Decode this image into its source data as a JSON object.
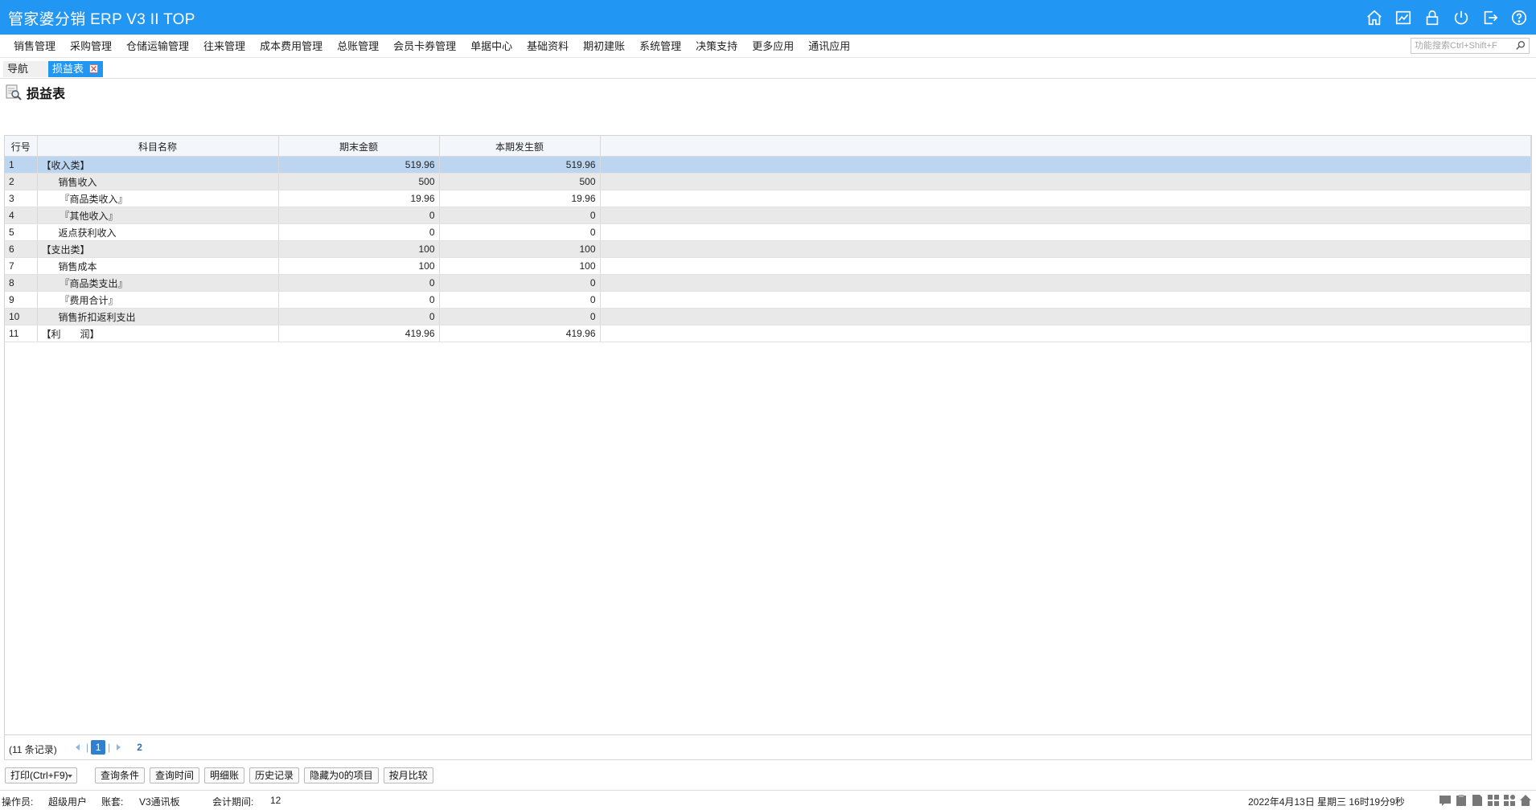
{
  "app": {
    "title": "管家婆分销 ERP V3 II TOP"
  },
  "menu": [
    {
      "label": "销售管理"
    },
    {
      "label": "采购管理"
    },
    {
      "label": "仓储运输管理"
    },
    {
      "label": "往来管理"
    },
    {
      "label": "成本费用管理"
    },
    {
      "label": "总账管理"
    },
    {
      "label": "会员卡券管理"
    },
    {
      "label": "单据中心"
    },
    {
      "label": "基础资料"
    },
    {
      "label": "期初建账"
    },
    {
      "label": "系统管理"
    },
    {
      "label": "决策支持"
    },
    {
      "label": "更多应用"
    },
    {
      "label": "通讯应用"
    }
  ],
  "search": {
    "placeholder": "功能搜索Ctrl+Shift+F"
  },
  "tabs": {
    "nav": "导航",
    "active": "损益表"
  },
  "page": {
    "title": "损益表"
  },
  "grid": {
    "headers": {
      "row": "行号",
      "name": "科目名称",
      "end": "期末金额",
      "period": "本期发生额"
    },
    "rows": [
      {
        "no": "1",
        "name": "【收入类】",
        "end": "519.96",
        "period": "519.96"
      },
      {
        "no": "2",
        "name": "销售收入",
        "end": "500",
        "period": "500"
      },
      {
        "no": "3",
        "name": "『商品类收入』",
        "end": "19.96",
        "period": "19.96"
      },
      {
        "no": "4",
        "name": "『其他收入』",
        "end": "0",
        "period": "0"
      },
      {
        "no": "5",
        "name": "返点获利收入",
        "end": "0",
        "period": "0"
      },
      {
        "no": "6",
        "name": "【支出类】",
        "end": "100",
        "period": "100"
      },
      {
        "no": "7",
        "name": "销售成本",
        "end": "100",
        "period": "100"
      },
      {
        "no": "8",
        "name": "『商品类支出』",
        "end": "0",
        "period": "0"
      },
      {
        "no": "9",
        "name": "『费用合计』",
        "end": "0",
        "period": "0"
      },
      {
        "no": "10",
        "name": "销售折扣返利支出",
        "end": "0",
        "period": "0"
      },
      {
        "no": "11",
        "name": "【利　　润】",
        "end": "419.96",
        "period": "419.96"
      }
    ]
  },
  "pager": {
    "records": "(11 条记录)",
    "current": "1",
    "total": "2"
  },
  "buttons": {
    "print": "打印(Ctrl+F9)",
    "query_cond": "查询条件",
    "query_time": "查询时间",
    "detail": "明细账",
    "history": "历史记录",
    "hide_zero": "隐藏为0的项目",
    "by_month": "按月比较"
  },
  "status": {
    "operator_label": "操作员:",
    "operator": "超级用户",
    "account_label": "账套:",
    "account": "V3通讯板",
    "period_label": "会计期间:",
    "period": "12",
    "datetime": "2022年4月13日  星期三  16时19分9秒"
  },
  "colors": {
    "primary": "#2196f3",
    "selected_row": "#bcd6f2",
    "alt_row": "#e9e9e9"
  },
  "icons": [
    "home-icon",
    "chart-icon",
    "lock-icon",
    "power-icon",
    "logout-icon",
    "help-icon",
    "search-icon",
    "close-icon",
    "report-magnifier-icon"
  ]
}
